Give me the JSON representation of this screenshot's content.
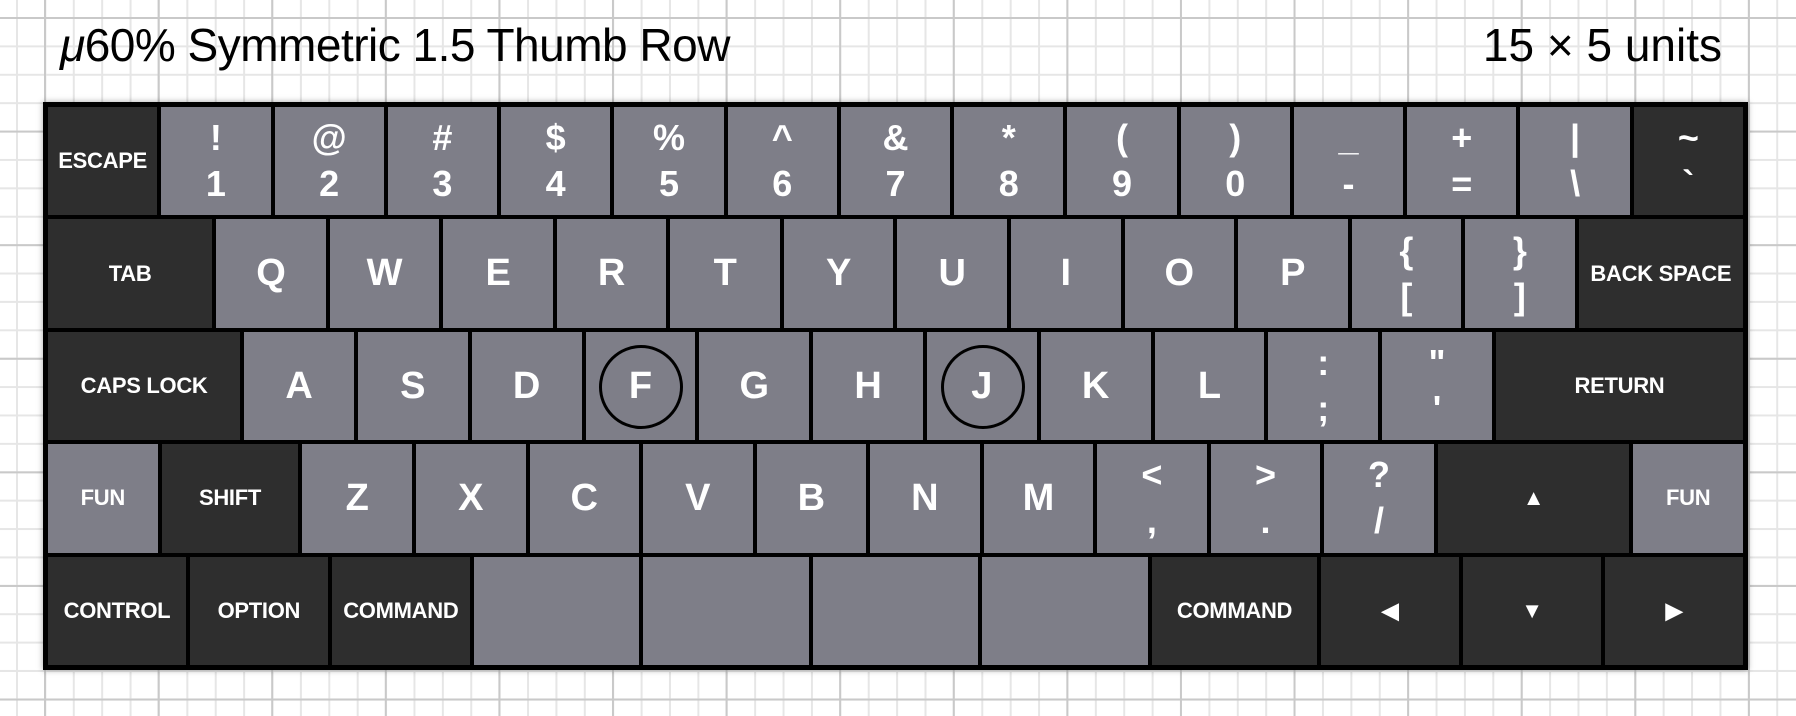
{
  "title": {
    "prefix": "μ",
    "text": "60% Symmetric 1.5 Thumb Row",
    "dimensions": "15 × 5 units"
  },
  "colors": {
    "dark_key": "#2e2e2e",
    "light_key": "#7e7e88",
    "legend": "#ffffff",
    "frame": "#000000"
  },
  "keyboard": {
    "units_wide": 15,
    "units_tall": 5,
    "rows": [
      [
        {
          "type": "mod",
          "label": "ESCAPE",
          "w": 1,
          "color": "dark"
        },
        {
          "type": "dual",
          "top": "!",
          "bottom": "1",
          "w": 1,
          "color": "light"
        },
        {
          "type": "dual",
          "top": "@",
          "bottom": "2",
          "w": 1,
          "color": "light"
        },
        {
          "type": "dual",
          "top": "#",
          "bottom": "3",
          "w": 1,
          "color": "light"
        },
        {
          "type": "dual",
          "top": "$",
          "bottom": "4",
          "w": 1,
          "color": "light"
        },
        {
          "type": "dual",
          "top": "%",
          "bottom": "5",
          "w": 1,
          "color": "light"
        },
        {
          "type": "dual",
          "top": "^",
          "bottom": "6",
          "w": 1,
          "color": "light"
        },
        {
          "type": "dual",
          "top": "&",
          "bottom": "7",
          "w": 1,
          "color": "light"
        },
        {
          "type": "dual",
          "top": "*",
          "bottom": "8",
          "w": 1,
          "color": "light"
        },
        {
          "type": "dual",
          "top": "(",
          "bottom": "9",
          "w": 1,
          "color": "light"
        },
        {
          "type": "dual",
          "top": ")",
          "bottom": "0",
          "w": 1,
          "color": "light"
        },
        {
          "type": "dual",
          "top": "_",
          "bottom": "-",
          "w": 1,
          "color": "light"
        },
        {
          "type": "dual",
          "top": "+",
          "bottom": "=",
          "w": 1,
          "color": "light"
        },
        {
          "type": "dual",
          "top": "|",
          "bottom": "\\",
          "w": 1,
          "color": "light"
        },
        {
          "type": "dual",
          "top": "~",
          "bottom": "`",
          "w": 1,
          "color": "dark"
        }
      ],
      [
        {
          "type": "mod",
          "label": "TAB",
          "w": 1.5,
          "color": "dark"
        },
        {
          "type": "letter",
          "label": "Q",
          "w": 1,
          "color": "light"
        },
        {
          "type": "letter",
          "label": "W",
          "w": 1,
          "color": "light"
        },
        {
          "type": "letter",
          "label": "E",
          "w": 1,
          "color": "light"
        },
        {
          "type": "letter",
          "label": "R",
          "w": 1,
          "color": "light"
        },
        {
          "type": "letter",
          "label": "T",
          "w": 1,
          "color": "light"
        },
        {
          "type": "letter",
          "label": "Y",
          "w": 1,
          "color": "light"
        },
        {
          "type": "letter",
          "label": "U",
          "w": 1,
          "color": "light"
        },
        {
          "type": "letter",
          "label": "I",
          "w": 1,
          "color": "light"
        },
        {
          "type": "letter",
          "label": "O",
          "w": 1,
          "color": "light"
        },
        {
          "type": "letter",
          "label": "P",
          "w": 1,
          "color": "light"
        },
        {
          "type": "dual",
          "top": "{",
          "bottom": "[",
          "w": 1,
          "color": "light"
        },
        {
          "type": "dual",
          "top": "}",
          "bottom": "]",
          "w": 1,
          "color": "light"
        },
        {
          "type": "mod",
          "label": "BACK SPACE",
          "w": 1.5,
          "color": "dark"
        }
      ],
      [
        {
          "type": "mod",
          "label": "CAPS LOCK",
          "w": 1.75,
          "color": "dark"
        },
        {
          "type": "letter",
          "label": "A",
          "w": 1,
          "color": "light"
        },
        {
          "type": "letter",
          "label": "S",
          "w": 1,
          "color": "light"
        },
        {
          "type": "letter",
          "label": "D",
          "w": 1,
          "color": "light"
        },
        {
          "type": "letter",
          "label": "F",
          "w": 1,
          "color": "light",
          "homing": true
        },
        {
          "type": "letter",
          "label": "G",
          "w": 1,
          "color": "light"
        },
        {
          "type": "letter",
          "label": "H",
          "w": 1,
          "color": "light"
        },
        {
          "type": "letter",
          "label": "J",
          "w": 1,
          "color": "light",
          "homing": true
        },
        {
          "type": "letter",
          "label": "K",
          "w": 1,
          "color": "light"
        },
        {
          "type": "letter",
          "label": "L",
          "w": 1,
          "color": "light"
        },
        {
          "type": "dual",
          "top": ":",
          "bottom": ";",
          "w": 1,
          "color": "light"
        },
        {
          "type": "dual",
          "top": "\"",
          "bottom": "'",
          "w": 1,
          "color": "light"
        },
        {
          "type": "mod",
          "label": "RETURN",
          "w": 2.25,
          "color": "dark"
        }
      ],
      [
        {
          "type": "mod",
          "label": "FUN",
          "w": 1,
          "color": "light"
        },
        {
          "type": "mod",
          "label": "SHIFT",
          "w": 1.25,
          "color": "dark"
        },
        {
          "type": "letter",
          "label": "Z",
          "w": 1,
          "color": "light"
        },
        {
          "type": "letter",
          "label": "X",
          "w": 1,
          "color": "light"
        },
        {
          "type": "letter",
          "label": "C",
          "w": 1,
          "color": "light"
        },
        {
          "type": "letter",
          "label": "V",
          "w": 1,
          "color": "light"
        },
        {
          "type": "letter",
          "label": "B",
          "w": 1,
          "color": "light"
        },
        {
          "type": "letter",
          "label": "N",
          "w": 1,
          "color": "light"
        },
        {
          "type": "letter",
          "label": "M",
          "w": 1,
          "color": "light"
        },
        {
          "type": "dual",
          "top": "<",
          "bottom": ",",
          "w": 1,
          "color": "light"
        },
        {
          "type": "dual",
          "top": ">",
          "bottom": ".",
          "w": 1,
          "color": "light"
        },
        {
          "type": "dual",
          "top": "?",
          "bottom": "/",
          "w": 1,
          "color": "light"
        },
        {
          "type": "arrow",
          "label": "▲",
          "icon": "arrow-up-icon",
          "w": 1.75,
          "color": "dark"
        },
        {
          "type": "mod",
          "label": "FUN",
          "w": 1,
          "color": "light"
        }
      ],
      [
        {
          "type": "mod",
          "label": "CONTROL",
          "w": 1.25,
          "color": "dark"
        },
        {
          "type": "mod",
          "label": "OPTION",
          "w": 1.25,
          "color": "dark"
        },
        {
          "type": "mod",
          "label": "COMMAND",
          "w": 1.25,
          "color": "dark"
        },
        {
          "type": "blank",
          "label": "",
          "w": 1.5,
          "color": "light"
        },
        {
          "type": "blank",
          "label": "",
          "w": 1.5,
          "color": "light"
        },
        {
          "type": "blank",
          "label": "",
          "w": 1.5,
          "color": "light"
        },
        {
          "type": "blank",
          "label": "",
          "w": 1.5,
          "color": "light"
        },
        {
          "type": "mod",
          "label": "COMMAND",
          "w": 1.5,
          "color": "dark"
        },
        {
          "type": "arrow",
          "label": "◀",
          "icon": "arrow-left-icon",
          "w": 1.25,
          "color": "dark"
        },
        {
          "type": "arrow",
          "label": "▼",
          "icon": "arrow-down-icon",
          "w": 1.25,
          "color": "dark"
        },
        {
          "type": "arrow",
          "label": "▶",
          "icon": "arrow-right-icon",
          "w": 1.25,
          "color": "dark"
        }
      ]
    ]
  }
}
